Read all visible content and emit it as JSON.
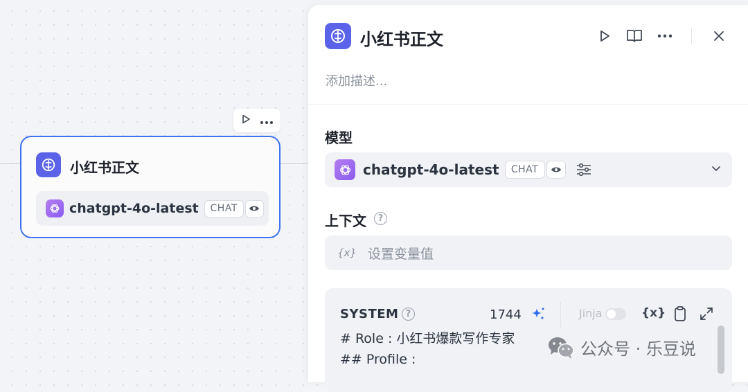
{
  "node": {
    "title": "小红书正文",
    "model_name": "chatgpt-4o-latest",
    "model_tag": "CHAT",
    "actions": [
      "play-icon",
      "more-icon"
    ]
  },
  "panel": {
    "title": "小红书正文",
    "description_placeholder": "添加描述...",
    "header_icons": [
      "play-icon",
      "book-icon",
      "more-icon",
      "close-icon"
    ],
    "model_section": {
      "label": "模型",
      "model_name": "chatgpt-4o-latest",
      "tag": "CHAT"
    },
    "context_section": {
      "label": "上下文",
      "help": "?",
      "var_icon_text": "{x}",
      "placeholder": "设置变量值"
    },
    "system": {
      "label": "SYSTEM",
      "help": "?",
      "token_count": "1744",
      "jinja_label": "Jinja",
      "jinja_enabled": false,
      "var_icon_text": "{x}",
      "lines": [
        "# Role : 小红书爆款写作专家",
        "## Profile :"
      ]
    }
  },
  "watermark": {
    "text": "公众号 · 乐豆说"
  },
  "colors": {
    "accent": "#3f74f0",
    "tool_icon": "#5b63e8",
    "gpt_logo": "#9b67f0",
    "sparkle": "#2f6bf0"
  }
}
